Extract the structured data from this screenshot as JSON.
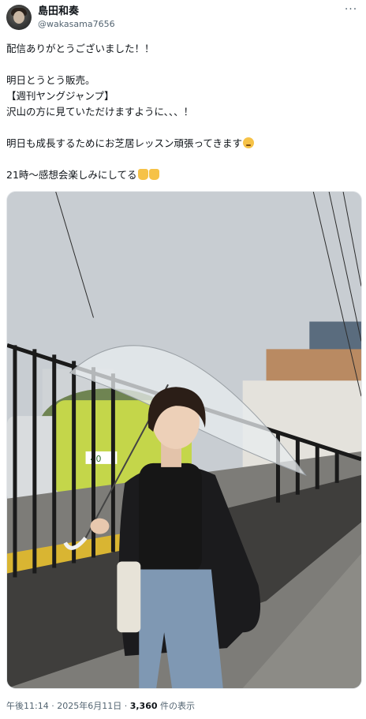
{
  "author": {
    "name": "島田和奏",
    "handle": "@wakasama7656",
    "more_label": "···"
  },
  "tweet": {
    "lines": [
      "配信ありがとうございました！！",
      "",
      "明日とうとう販売。",
      "【週刊ヤングジャンプ】",
      "沢山の方に見ていただけますように、、、！",
      "",
      "明日も成長するためにお芝居レッスン頑張ってきます",
      "",
      "21時〜感想会楽しみにしてる"
    ],
    "emojis": {
      "line7": "face-emoji",
      "line9": [
        "thumbs-up-emoji",
        "thumbs-up-emoji"
      ]
    }
  },
  "photo": {
    "plate_number": "40",
    "sky_color": "#c8cdd2",
    "car_color": "#c4d64a"
  },
  "meta": {
    "time": "午後11:14",
    "sep1": " · ",
    "date": "2025年6月11日",
    "sep2": " · ",
    "views": "3,360",
    "views_suffix": " 件の表示"
  }
}
